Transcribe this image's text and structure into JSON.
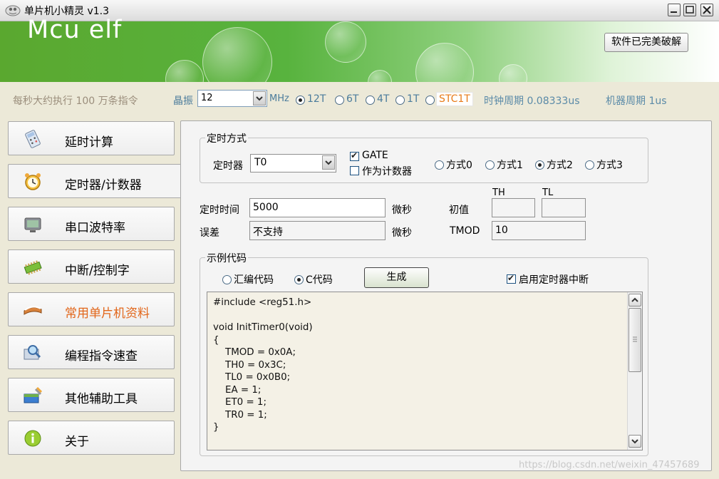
{
  "window": {
    "title": "单片机小精灵  v1.3",
    "banner_title": "Mcu elf",
    "crack_button": "软件已完美破解"
  },
  "info": {
    "speed": "每秒大约执行 100 万条指令",
    "crystal_label": "晶振",
    "crystal_value": "12",
    "mhz": "MHz",
    "modes": [
      {
        "label": "12T",
        "selected": true
      },
      {
        "label": "6T",
        "selected": false
      },
      {
        "label": "4T",
        "selected": false
      },
      {
        "label": "1T",
        "selected": false
      },
      {
        "label": "STC1T",
        "selected": false
      }
    ],
    "clock_period": "时钟周期 0.08333us",
    "machine_period": "机器周期 1us"
  },
  "nav": {
    "items": [
      {
        "label": "延时计算",
        "icon": "calculator-icon"
      },
      {
        "label": "定时器/计数器",
        "icon": "alarm-clock-icon"
      },
      {
        "label": "串口波特率",
        "icon": "monitor-icon"
      },
      {
        "label": "中断/控制字",
        "icon": "chip-icon"
      },
      {
        "label": "常用单片机资料",
        "icon": "book-icon"
      },
      {
        "label": "编程指令速查",
        "icon": "magnifier-icon"
      },
      {
        "label": "其他辅助工具",
        "icon": "toolbox-icon"
      },
      {
        "label": "关于",
        "icon": "info-icon"
      }
    ],
    "active_index": 1
  },
  "timer_mode": {
    "legend": "定时方式",
    "timer_label": "定时器",
    "timer_value": "T0",
    "gate_label": "GATE",
    "gate_checked": true,
    "counter_label": "作为计数器",
    "counter_checked": false,
    "modes": [
      {
        "label": "方式0",
        "selected": false
      },
      {
        "label": "方式1",
        "selected": false
      },
      {
        "label": "方式2",
        "selected": true
      },
      {
        "label": "方式3",
        "selected": false
      }
    ]
  },
  "timing": {
    "time_label": "定时时间",
    "time_value": "5000",
    "time_unit": "微秒",
    "error_label": "误差",
    "error_value": "不支持",
    "error_unit": "微秒",
    "initial_label": "初值",
    "th_label": "TH",
    "tl_label": "TL",
    "th_value": "",
    "tl_value": "",
    "tmod_label": "TMOD",
    "tmod_value": "10"
  },
  "example": {
    "legend": "示例代码",
    "asm_label": "汇编代码",
    "c_label": "C代码",
    "c_selected": true,
    "generate_button": "生成",
    "enable_interrupt_label": "启用定时器中断",
    "enable_interrupt_checked": true,
    "code": "#include <reg51.h>\n\nvoid InitTimer0(void)\n{\n    TMOD = 0x0A;\n    TH0 = 0x3C;\n    TL0 = 0x0B0;\n    EA = 1;\n    ET0 = 1;\n    TR0 = 1;\n}"
  },
  "watermark": "https://blog.csdn.net/weixin_47457689",
  "colors": {
    "active_nav_text": "#e2661a",
    "stc1t_text": "#e87b1a",
    "info_blue": "#5a8aa8"
  }
}
